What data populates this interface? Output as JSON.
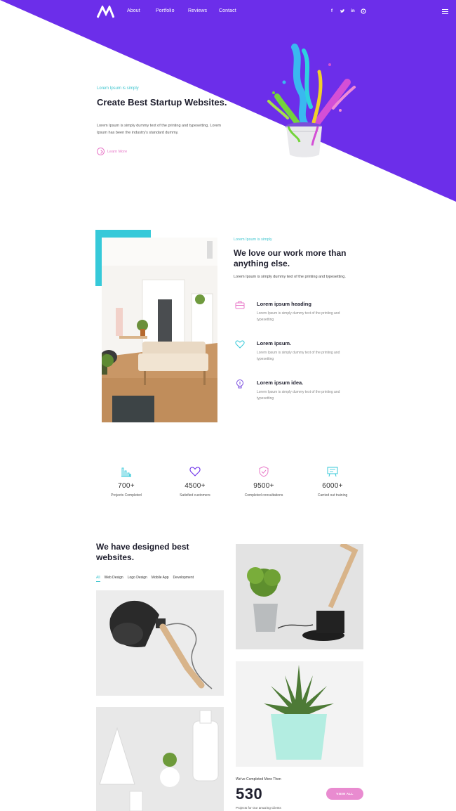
{
  "colors": {
    "brand_purple": "#6c2eea",
    "accent_cyan": "#36c9d9",
    "accent_pink": "#e879c8",
    "heading": "#1f1f2e"
  },
  "nav": {
    "links": [
      "About",
      "Portfolio",
      "Reviews",
      "Contact"
    ],
    "social_icons": [
      "facebook-icon",
      "twitter-icon",
      "linkedin-icon",
      "pinterest-icon"
    ],
    "menu_icon": "hamburger-menu-icon"
  },
  "hero": {
    "eyebrow": "Lorem Ipsum is simply",
    "title": "Create Best Startup Websites.",
    "description": "Lorem Ipsum is simply dummy text of the printing and typesetting. Lorem Ipsum has been the industry's standard dummy.",
    "link_label": "Learn More"
  },
  "about": {
    "eyebrow": "Lorem Ipsum is simply",
    "title": "We love our work more than anything else.",
    "description": "Lorem Ipsum is simply dummy text of the printing and typesetting.",
    "features": [
      {
        "icon": "briefcase-icon",
        "heading": "Lorem ipsum heading",
        "text": "Lorem Ipsum is simply dummy text of the printing and typesetting"
      },
      {
        "icon": "heart-icon",
        "heading": "Lorem ipsum.",
        "text": "Lorem Ipsum is simply dummy text of the printing and typesetting"
      },
      {
        "icon": "lightbulb-icon",
        "heading": "Lorem ipsum idea.",
        "text": "Lorem Ipsum is simply dummy text of the printing and typesetting"
      }
    ]
  },
  "stats": [
    {
      "icon": "bar-chart-icon",
      "value": "700+",
      "label": "Projects Completed"
    },
    {
      "icon": "heart-icon",
      "value": "4500+",
      "label": "Satisfied customers"
    },
    {
      "icon": "shield-check-icon",
      "value": "9500+",
      "label": "Completed consultations"
    },
    {
      "icon": "presentation-board-icon",
      "value": "6000+",
      "label": "Carried out training"
    }
  ],
  "portfolio": {
    "title": "We have designed best websites.",
    "filters": [
      "All",
      "Web Design",
      "Logo Design",
      "Mobile App",
      "Development"
    ],
    "active_filter": "All"
  },
  "cta": {
    "eyebrow": "We've Completed More Then",
    "number": "530",
    "subtext": "Projects for Our amazing Clients",
    "button": "VIEW ALL"
  }
}
